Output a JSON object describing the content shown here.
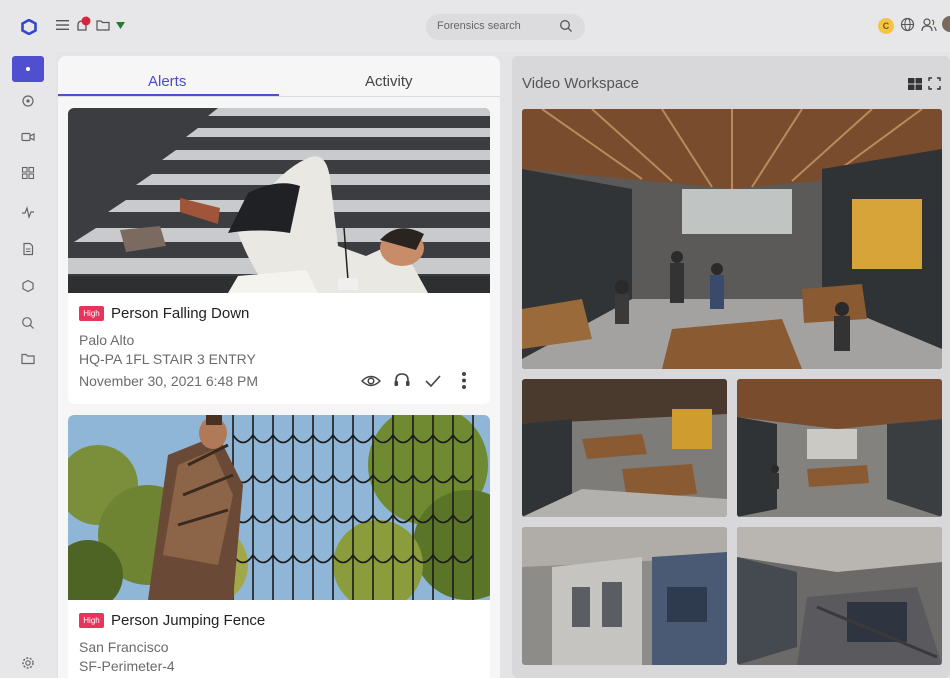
{
  "header": {
    "search_label": "Forensics search",
    "user_initial": "C",
    "accent": "#4f4fd0",
    "notification_color": "#d9243a",
    "status_color": "#1e7d33"
  },
  "sidebar": {
    "items": [
      "home-icon",
      "location-icon",
      "camera-icon",
      "dashboard-icon",
      "activity-icon",
      "report-icon",
      "hexagon-icon",
      "search-icon",
      "folder-icon"
    ],
    "settings_icon": "gear-icon"
  },
  "alerts": {
    "tabs": [
      {
        "label": "Alerts",
        "active": true
      },
      {
        "label": "Activity",
        "active": false
      }
    ],
    "cards": [
      {
        "severity": "High",
        "title": "Person Falling Down",
        "location": "Palo Alto",
        "camera": "HQ-PA 1FL STAIR 3 ENTRY",
        "timestamp": "November 30, 2021 6:48 PM",
        "actions": [
          "eye-icon",
          "headset-icon",
          "checkmark-icon",
          "more-vertical-icon"
        ]
      },
      {
        "severity": "High",
        "title": "Person Jumping Fence",
        "location": "San Francisco",
        "camera": "SF-Perimeter-4"
      }
    ],
    "severity_color": "#e8345c"
  },
  "workspace": {
    "title": "Video Workspace",
    "feeds": [
      "feed-1",
      "feed-2",
      "feed-3",
      "feed-4",
      "feed-5"
    ]
  }
}
